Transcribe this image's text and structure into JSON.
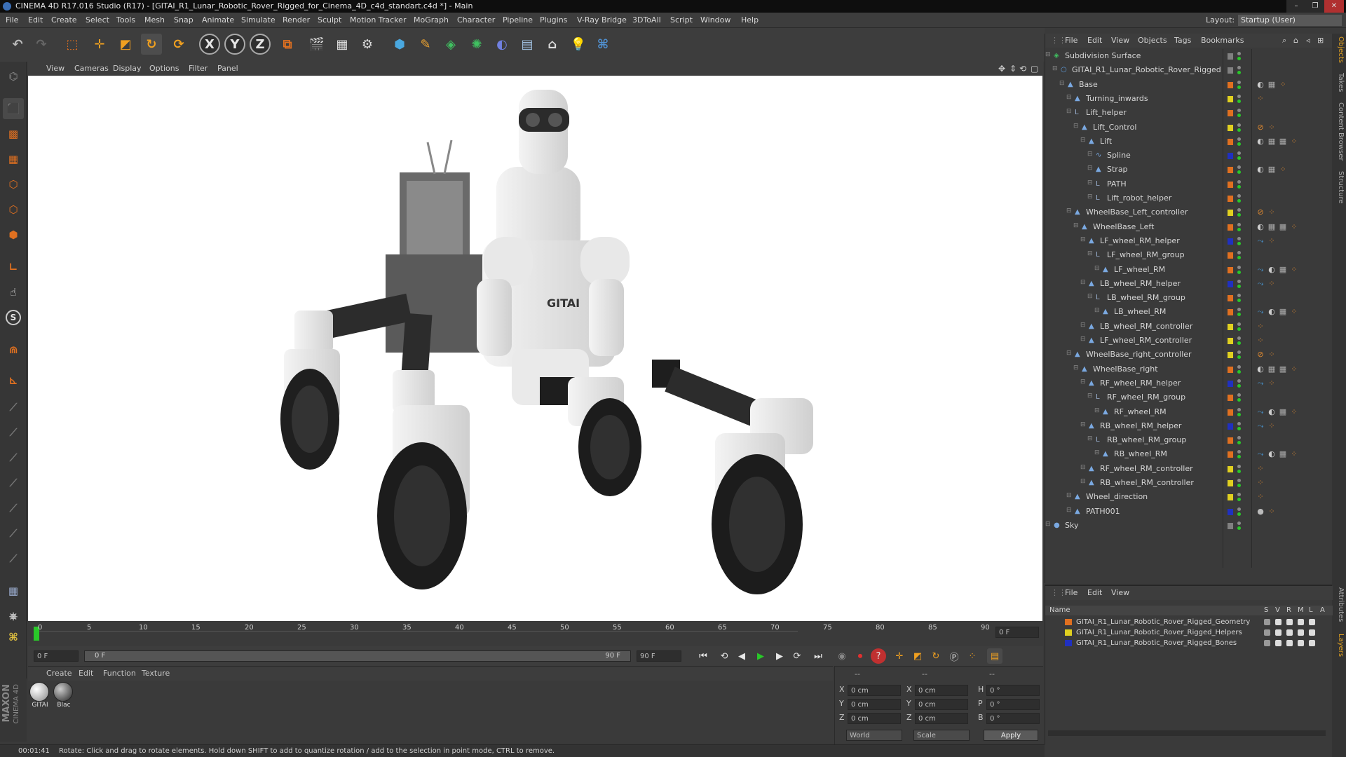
{
  "window": {
    "title": "CINEMA 4D R17.016 Studio (R17) - [GITAI_R1_Lunar_Robotic_Rover_Rigged_for_Cinema_4D_c4d_standart.c4d *] - Main",
    "buttons": [
      "–",
      "❐",
      "✕"
    ]
  },
  "menu": [
    "File",
    "Edit",
    "Create",
    "Select",
    "Tools",
    "Mesh",
    "Snap",
    "Animate",
    "Simulate",
    "Render",
    "Sculpt",
    "Motion Tracker",
    "MoGraph",
    "Character",
    "Pipeline",
    "Plugins",
    "V-Ray Bridge",
    "3DToAll",
    "Script",
    "Window",
    "Help"
  ],
  "layout": {
    "label": "Layout:",
    "value": "Startup (User)"
  },
  "toolbar": {
    "icons": [
      "undo-icon",
      "redo-icon",
      "live-selection-icon",
      "move-icon",
      "scale-icon",
      "rotate-icon",
      "recent-tool-icon",
      "x-axis-icon",
      "y-axis-icon",
      "z-axis-icon",
      "coordinate-system-icon",
      "render-view-icon",
      "render-picture-viewer-icon",
      "edit-render-settings-icon",
      "cube-icon",
      "pen-spline-icon",
      "subdivision-icon",
      "array-icon",
      "deformer-icon",
      "floor-icon",
      "camera-icon",
      "light-icon",
      "python-icon"
    ],
    "axis_labels": [
      "X",
      "Y",
      "Z"
    ]
  },
  "left_toolbar": {
    "icons": [
      "make-editable-icon",
      "model-mode-icon",
      "texture-mode-icon",
      "workplane-icon",
      "points-mode-icon",
      "edges-mode-icon",
      "polygons-mode-icon",
      "axis-mode-icon",
      "tweak-icon",
      "snap-icon",
      "magnet-icon",
      "quantize-icon",
      "brush-1-icon",
      "brush-2-icon",
      "brush-3-icon",
      "brush-4-icon",
      "brush-5-icon",
      "brush-6-icon",
      "brush-7-icon",
      "lock-workplane-icon",
      "render-icon",
      "python-console-icon"
    ],
    "snap_label": "S"
  },
  "viewport": {
    "menu": [
      "View",
      "Cameras",
      "Display",
      "Options",
      "Filter",
      "Panel"
    ],
    "robot_badge": "GITAI"
  },
  "timeline": {
    "ticks": [
      "0",
      "5",
      "10",
      "15",
      "20",
      "25",
      "30",
      "35",
      "40",
      "45",
      "50",
      "55",
      "60",
      "65",
      "70",
      "75",
      "80",
      "85",
      "90"
    ],
    "current_frame": "0 F",
    "start_field": "0 F",
    "slider_start": "0 F",
    "slider_end": "90 F",
    "end_field": "90 F"
  },
  "materials": {
    "menu": [
      "Create",
      "Edit",
      "Function",
      "Texture"
    ],
    "items": [
      {
        "name": "GITAI"
      },
      {
        "name": "Blac"
      }
    ]
  },
  "coordinates": {
    "rows": [
      {
        "a": "X",
        "av": "0 cm",
        "b": "X",
        "bv": "0 cm",
        "c": "H",
        "cv": "0 °"
      },
      {
        "a": "Y",
        "av": "0 cm",
        "b": "Y",
        "bv": "0 cm",
        "c": "P",
        "cv": "0 °"
      },
      {
        "a": "Z",
        "av": "0 cm",
        "b": "Z",
        "bv": "0 cm",
        "c": "B",
        "cv": "0 °"
      }
    ],
    "top_dashes": [
      "--",
      "--",
      "--"
    ],
    "world": "World",
    "scale": "Scale",
    "apply": "Apply"
  },
  "maxon": {
    "line1": "MAXON",
    "line2": "CINEMA 4D"
  },
  "status": {
    "time": "00:01:41",
    "message": "Rotate: Click and drag to rotate elements. Hold down SHIFT to add to quantize rotation / add to the selection in point mode, CTRL to remove."
  },
  "objects": {
    "menu": [
      "File",
      "Edit",
      "View",
      "Objects",
      "Tags",
      "Bookmarks"
    ],
    "tree": [
      {
        "name": "Subdivision Surface",
        "depth": 0,
        "icon": "subdivision",
        "layer": "#808080",
        "tags": []
      },
      {
        "name": "GITAI_R1_Lunar_Robotic_Rover_Rigged",
        "depth": 1,
        "icon": "null",
        "layer": "#808080",
        "tags": []
      },
      {
        "name": "Base",
        "depth": 2,
        "icon": "joint",
        "layer": "#e07020",
        "tags": [
          "phong",
          "checker",
          "dots"
        ]
      },
      {
        "name": "Turning_inwards",
        "depth": 3,
        "icon": "joint",
        "layer": "#e0d020",
        "tags": [
          "dots"
        ]
      },
      {
        "name": "Lift_helper",
        "depth": 3,
        "icon": "null-l",
        "layer": "#e07020",
        "tags": []
      },
      {
        "name": "Lift_Control",
        "depth": 4,
        "icon": "joint",
        "layer": "#e0d020",
        "tags": [
          "constraint",
          "dots"
        ]
      },
      {
        "name": "Lift",
        "depth": 5,
        "icon": "joint",
        "layer": "#e07020",
        "tags": [
          "phong",
          "checker",
          "checker",
          "dots"
        ]
      },
      {
        "name": "Spline",
        "depth": 6,
        "icon": "spline",
        "layer": "#2030c0",
        "tags": []
      },
      {
        "name": "Strap",
        "depth": 6,
        "icon": "joint",
        "layer": "#e07020",
        "tags": [
          "phong",
          "checker",
          "dots"
        ]
      },
      {
        "name": "PATH",
        "depth": 6,
        "icon": "null-l",
        "layer": "#e07020",
        "tags": []
      },
      {
        "name": "Lift_robot_helper",
        "depth": 6,
        "icon": "null-l",
        "layer": "#e07020",
        "tags": []
      },
      {
        "name": "WheelBase_Left_controller",
        "depth": 3,
        "icon": "joint",
        "layer": "#e0d020",
        "tags": [
          "constraint",
          "dots"
        ]
      },
      {
        "name": "WheelBase_Left",
        "depth": 4,
        "icon": "joint",
        "layer": "#e07020",
        "tags": [
          "phong",
          "checker",
          "checker",
          "dots"
        ]
      },
      {
        "name": "LF_wheel_RM_helper",
        "depth": 5,
        "icon": "joint",
        "layer": "#2030c0",
        "tags": [
          "ik",
          "dots"
        ]
      },
      {
        "name": "LF_wheel_RM_group",
        "depth": 6,
        "icon": "null-l",
        "layer": "#e07020",
        "tags": []
      },
      {
        "name": "LF_wheel_RM",
        "depth": 7,
        "icon": "joint",
        "layer": "#e07020",
        "tags": [
          "ik",
          "phong",
          "checker",
          "dots"
        ]
      },
      {
        "name": "LB_wheel_RM_helper",
        "depth": 5,
        "icon": "joint",
        "layer": "#2030c0",
        "tags": [
          "ik",
          "dots"
        ]
      },
      {
        "name": "LB_wheel_RM_group",
        "depth": 6,
        "icon": "null-l",
        "layer": "#e07020",
        "tags": []
      },
      {
        "name": "LB_wheel_RM",
        "depth": 7,
        "icon": "joint",
        "layer": "#e07020",
        "tags": [
          "ik",
          "phong",
          "checker",
          "dots"
        ]
      },
      {
        "name": "LB_wheel_RM_controller",
        "depth": 5,
        "icon": "joint",
        "layer": "#e0d020",
        "tags": [
          "dots"
        ]
      },
      {
        "name": "LF_wheel_RM_controller",
        "depth": 5,
        "icon": "joint",
        "layer": "#e0d020",
        "tags": [
          "dots"
        ]
      },
      {
        "name": "WheelBase_right_controller",
        "depth": 3,
        "icon": "joint",
        "layer": "#e0d020",
        "tags": [
          "constraint",
          "dots"
        ]
      },
      {
        "name": "WheelBase_right",
        "depth": 4,
        "icon": "joint",
        "layer": "#e07020",
        "tags": [
          "phong",
          "checker",
          "checker",
          "dots"
        ]
      },
      {
        "name": "RF_wheel_RM_helper",
        "depth": 5,
        "icon": "joint",
        "layer": "#2030c0",
        "tags": [
          "ik",
          "dots"
        ]
      },
      {
        "name": "RF_wheel_RM_group",
        "depth": 6,
        "icon": "null-l",
        "layer": "#e07020",
        "tags": []
      },
      {
        "name": "RF_wheel_RM",
        "depth": 7,
        "icon": "joint",
        "layer": "#e07020",
        "tags": [
          "ik",
          "phong",
          "checker",
          "dots"
        ]
      },
      {
        "name": "RB_wheel_RM_helper",
        "depth": 5,
        "icon": "joint",
        "layer": "#2030c0",
        "tags": [
          "ik",
          "dots"
        ]
      },
      {
        "name": "RB_wheel_RM_group",
        "depth": 6,
        "icon": "null-l",
        "layer": "#e07020",
        "tags": []
      },
      {
        "name": "RB_wheel_RM",
        "depth": 7,
        "icon": "joint",
        "layer": "#e07020",
        "tags": [
          "ik",
          "phong",
          "checker",
          "dots"
        ]
      },
      {
        "name": "RF_wheel_RM_controller",
        "depth": 5,
        "icon": "joint",
        "layer": "#e0d020",
        "tags": [
          "dots"
        ]
      },
      {
        "name": "RB_wheel_RM_controller",
        "depth": 5,
        "icon": "joint",
        "layer": "#e0d020",
        "tags": [
          "dots"
        ]
      },
      {
        "name": "Wheel_direction",
        "depth": 3,
        "icon": "joint",
        "layer": "#e0d020",
        "tags": [
          "dots"
        ]
      },
      {
        "name": "PATH001",
        "depth": 3,
        "icon": "joint",
        "layer": "#2030c0",
        "tags": [
          "material",
          "dots"
        ]
      },
      {
        "name": "Sky",
        "depth": 0,
        "icon": "sky",
        "layer": "#808080",
        "tags": []
      }
    ]
  },
  "layers": {
    "menu": [
      "File",
      "Edit",
      "View"
    ],
    "columns": [
      "Name",
      "S",
      "V",
      "R",
      "M",
      "L",
      "A"
    ],
    "items": [
      {
        "name": "GITAI_R1_Lunar_Robotic_Rover_Rigged_Geometry",
        "color": "#e07020"
      },
      {
        "name": "GITAI_R1_Lunar_Robotic_Rover_Rigged_Helpers",
        "color": "#e0d020"
      },
      {
        "name": "GITAI_R1_Lunar_Robotic_Rover_Rigged_Bones",
        "color": "#2030c0"
      }
    ]
  },
  "side_tabs": [
    "Objects",
    "Takes",
    "Content Browser",
    "Structure",
    "Attributes",
    "Layers"
  ]
}
